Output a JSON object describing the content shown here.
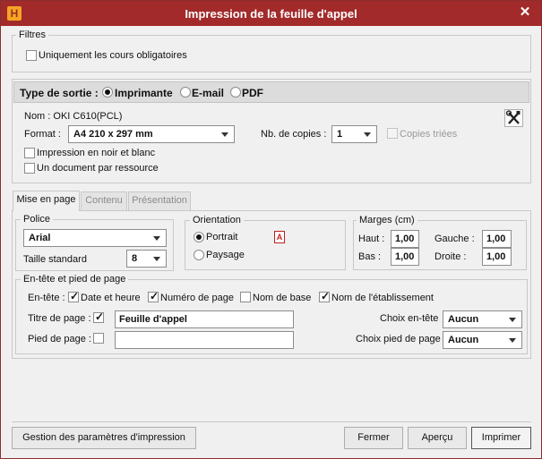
{
  "window": {
    "title": "Impression de la feuille d'appel",
    "app_icon": "H",
    "close": "✕"
  },
  "filtres": {
    "legend": "Filtres",
    "obligatoires_label": "Uniquement les cours obligatoires",
    "obligatoires_checked": false
  },
  "sortie": {
    "label": "Type de sortie :",
    "options": [
      "Imprimante",
      "E-mail",
      "PDF"
    ],
    "selected": "Imprimante",
    "nom": "Nom : OKI C610(PCL)",
    "format_label": "Format :",
    "format_value": "A4 210 x 297 mm",
    "copies_label": "Nb. de copies :",
    "copies_value": "1",
    "copies_triees_label": "Copies triées",
    "noir_blanc_label": "Impression en noir et blanc",
    "un_document_label": "Un document par ressource"
  },
  "tabs": [
    "Mise en page",
    "Contenu",
    "Présentation"
  ],
  "active_tab": "Mise en page",
  "police": {
    "legend": "Police",
    "font_value": "Arial",
    "taille_label": "Taille standard",
    "taille_value": "8"
  },
  "orientation": {
    "legend": "Orientation",
    "portrait": "Portrait",
    "paysage": "Paysage",
    "selected": "Portrait",
    "preview_glyph": "A"
  },
  "marges": {
    "legend": "Marges (cm)",
    "haut_label": "Haut :",
    "haut": "1,00",
    "bas_label": "Bas :",
    "bas": "1,00",
    "gauche_label": "Gauche :",
    "gauche": "1,00",
    "droite_label": "Droite :",
    "droite": "1,00"
  },
  "entete": {
    "legend": "En-tête et pied de page",
    "entete_label": "En-tête :",
    "items": [
      {
        "label": "Date et heure",
        "checked": true
      },
      {
        "label": "Numéro de page",
        "checked": true
      },
      {
        "label": "Nom de base",
        "checked": false
      },
      {
        "label": "Nom de l'établissement",
        "checked": true
      }
    ],
    "titre_label": "Titre de page :",
    "titre_value": "Feuille d'appel",
    "pied_label": "Pied de page :",
    "pied_value": "",
    "choix_entete_label": "Choix en-tête",
    "choix_entete_value": "Aucun",
    "choix_pied_label": "Choix pied de page",
    "choix_pied_value": "Aucun"
  },
  "buttons": {
    "gestion": "Gestion des paramètres d'impression",
    "fermer": "Fermer",
    "apercu": "Aperçu",
    "imprimer": "Imprimer"
  },
  "icons": {
    "tools": "tools-icon",
    "check": "✓"
  }
}
